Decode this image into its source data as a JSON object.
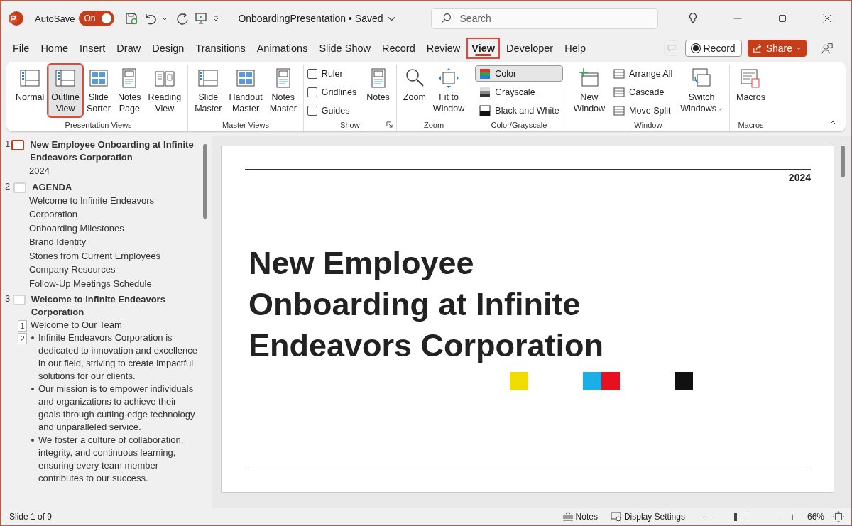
{
  "titlebar": {
    "autosave": {
      "label": "AutoSave",
      "on": true,
      "state": "On"
    },
    "document_title": "OnboardingPresentation • Saved",
    "search": {
      "placeholder": "Search"
    }
  },
  "tabs": [
    {
      "label": "File",
      "selected": false
    },
    {
      "label": "Home",
      "selected": false
    },
    {
      "label": "Insert",
      "selected": false
    },
    {
      "label": "Draw",
      "selected": false
    },
    {
      "label": "Design",
      "selected": false
    },
    {
      "label": "Transitions",
      "selected": false
    },
    {
      "label": "Animations",
      "selected": false
    },
    {
      "label": "Slide Show",
      "selected": false
    },
    {
      "label": "Record",
      "selected": false
    },
    {
      "label": "Review",
      "selected": false
    },
    {
      "label": "View",
      "selected": true
    },
    {
      "label": "Developer",
      "selected": false
    },
    {
      "label": "Help",
      "selected": false
    }
  ],
  "tab_actions": {
    "comments": {
      "disabled": true
    },
    "record": "Record",
    "share": "Share"
  },
  "ribbon": [
    {
      "label": "Presentation Views",
      "launcher": false,
      "items": [
        {
          "kind": "big",
          "label": "Normal",
          "selected": false
        },
        {
          "kind": "big",
          "label": "Outline\nView",
          "selected": true
        },
        {
          "kind": "big",
          "label": "Slide\nSorter",
          "selected": false
        },
        {
          "kind": "big",
          "label": "Notes\nPage",
          "selected": false
        },
        {
          "kind": "big",
          "label": "Reading\nView",
          "selected": false
        }
      ]
    },
    {
      "label": "Master Views",
      "launcher": false,
      "items": [
        {
          "kind": "big",
          "label": "Slide\nMaster",
          "selected": false
        },
        {
          "kind": "big",
          "label": "Handout\nMaster",
          "selected": false
        },
        {
          "kind": "big",
          "label": "Notes\nMaster",
          "selected": false
        }
      ]
    },
    {
      "label": "Show",
      "launcher": true,
      "items": [
        {
          "kind": "check",
          "label": "Ruler",
          "checked": false
        },
        {
          "kind": "check",
          "label": "Gridlines",
          "checked": false
        },
        {
          "kind": "check",
          "label": "Guides",
          "checked": false
        },
        {
          "kind": "big",
          "label": "Notes",
          "selected": false
        }
      ]
    },
    {
      "label": "Zoom",
      "launcher": false,
      "items": [
        {
          "kind": "big",
          "label": "Zoom",
          "selected": false
        },
        {
          "kind": "big",
          "label": "Fit to\nWindow",
          "selected": false
        }
      ]
    },
    {
      "label": "Color/Grayscale",
      "launcher": false,
      "items": [
        {
          "kind": "small",
          "label": "Color",
          "selected": true
        },
        {
          "kind": "small",
          "label": "Grayscale",
          "selected": false
        },
        {
          "kind": "small",
          "label": "Black and White",
          "selected": false
        }
      ]
    },
    {
      "label": "Window",
      "launcher": false,
      "items": [
        {
          "kind": "big",
          "label": "New\nWindow",
          "selected": false
        },
        {
          "kind": "small",
          "label": "Arrange All",
          "selected": false
        },
        {
          "kind": "small",
          "label": "Cascade",
          "selected": false
        },
        {
          "kind": "small",
          "label": "Move Split",
          "selected": false
        },
        {
          "kind": "menu",
          "label": "Switch\nWindows",
          "selected": false
        }
      ]
    },
    {
      "label": "Macros",
      "launcher": false,
      "items": [
        {
          "kind": "big",
          "label": "Macros",
          "selected": false
        }
      ]
    }
  ],
  "outline": [
    {
      "number": "1",
      "selected": true,
      "title": "New Employee Onboarding at Infinite Endeavors Corporation",
      "lines": [
        {
          "kind": "plain",
          "text": "2024"
        }
      ]
    },
    {
      "number": "2",
      "selected": false,
      "title": "AGENDA",
      "lines": [
        {
          "kind": "plain",
          "text": "Welcome to Infinite Endeavors Corporation"
        },
        {
          "kind": "plain",
          "text": "Onboarding Milestones"
        },
        {
          "kind": "plain",
          "text": "Brand Identity"
        },
        {
          "kind": "plain",
          "text": "Stories from Current Employees"
        },
        {
          "kind": "plain",
          "text": "Company Resources"
        },
        {
          "kind": "plain",
          "text": "Follow-Up Meetings Schedule"
        }
      ]
    },
    {
      "number": "3",
      "selected": false,
      "title": "Welcome to Infinite Endeavors Corporation",
      "lines": [
        {
          "kind": "numbered",
          "number": "1",
          "text": "Welcome to Our Team"
        },
        {
          "kind": "bullets",
          "number": "2",
          "children": [
            {
              "text": "Infinite Endeavors Corporation is dedicated to innovation and excellence in our field, striving to create impactful solutions for our clients."
            },
            {
              "text": "Our mission is to empower individuals and organizations to achieve their goals through cutting-edge technology and unparalleled service."
            },
            {
              "text": "We foster a culture of collaboration, integrity, and continuous learning, ensuring every team member contributes to our success."
            }
          ]
        }
      ]
    }
  ],
  "slide": {
    "date": "2024",
    "title": "New Employee Onboarding at Infinite Endeavors Corporation",
    "swatch_groups": [
      {
        "swatches": [
          {
            "color": "#f0dc00"
          }
        ]
      },
      {
        "swatches": [
          {
            "color": "#1aafe6"
          },
          {
            "color": "#e8101e"
          }
        ]
      },
      {
        "swatches": [
          {
            "color": "#111111"
          }
        ]
      }
    ]
  },
  "status_bar": {
    "slide_position": "Slide 1 of 9",
    "notes": "Notes",
    "display_settings": "Display Settings",
    "zoom": {
      "minus": "−",
      "plus": "+",
      "level": 0.33,
      "reading": "66%"
    }
  }
}
